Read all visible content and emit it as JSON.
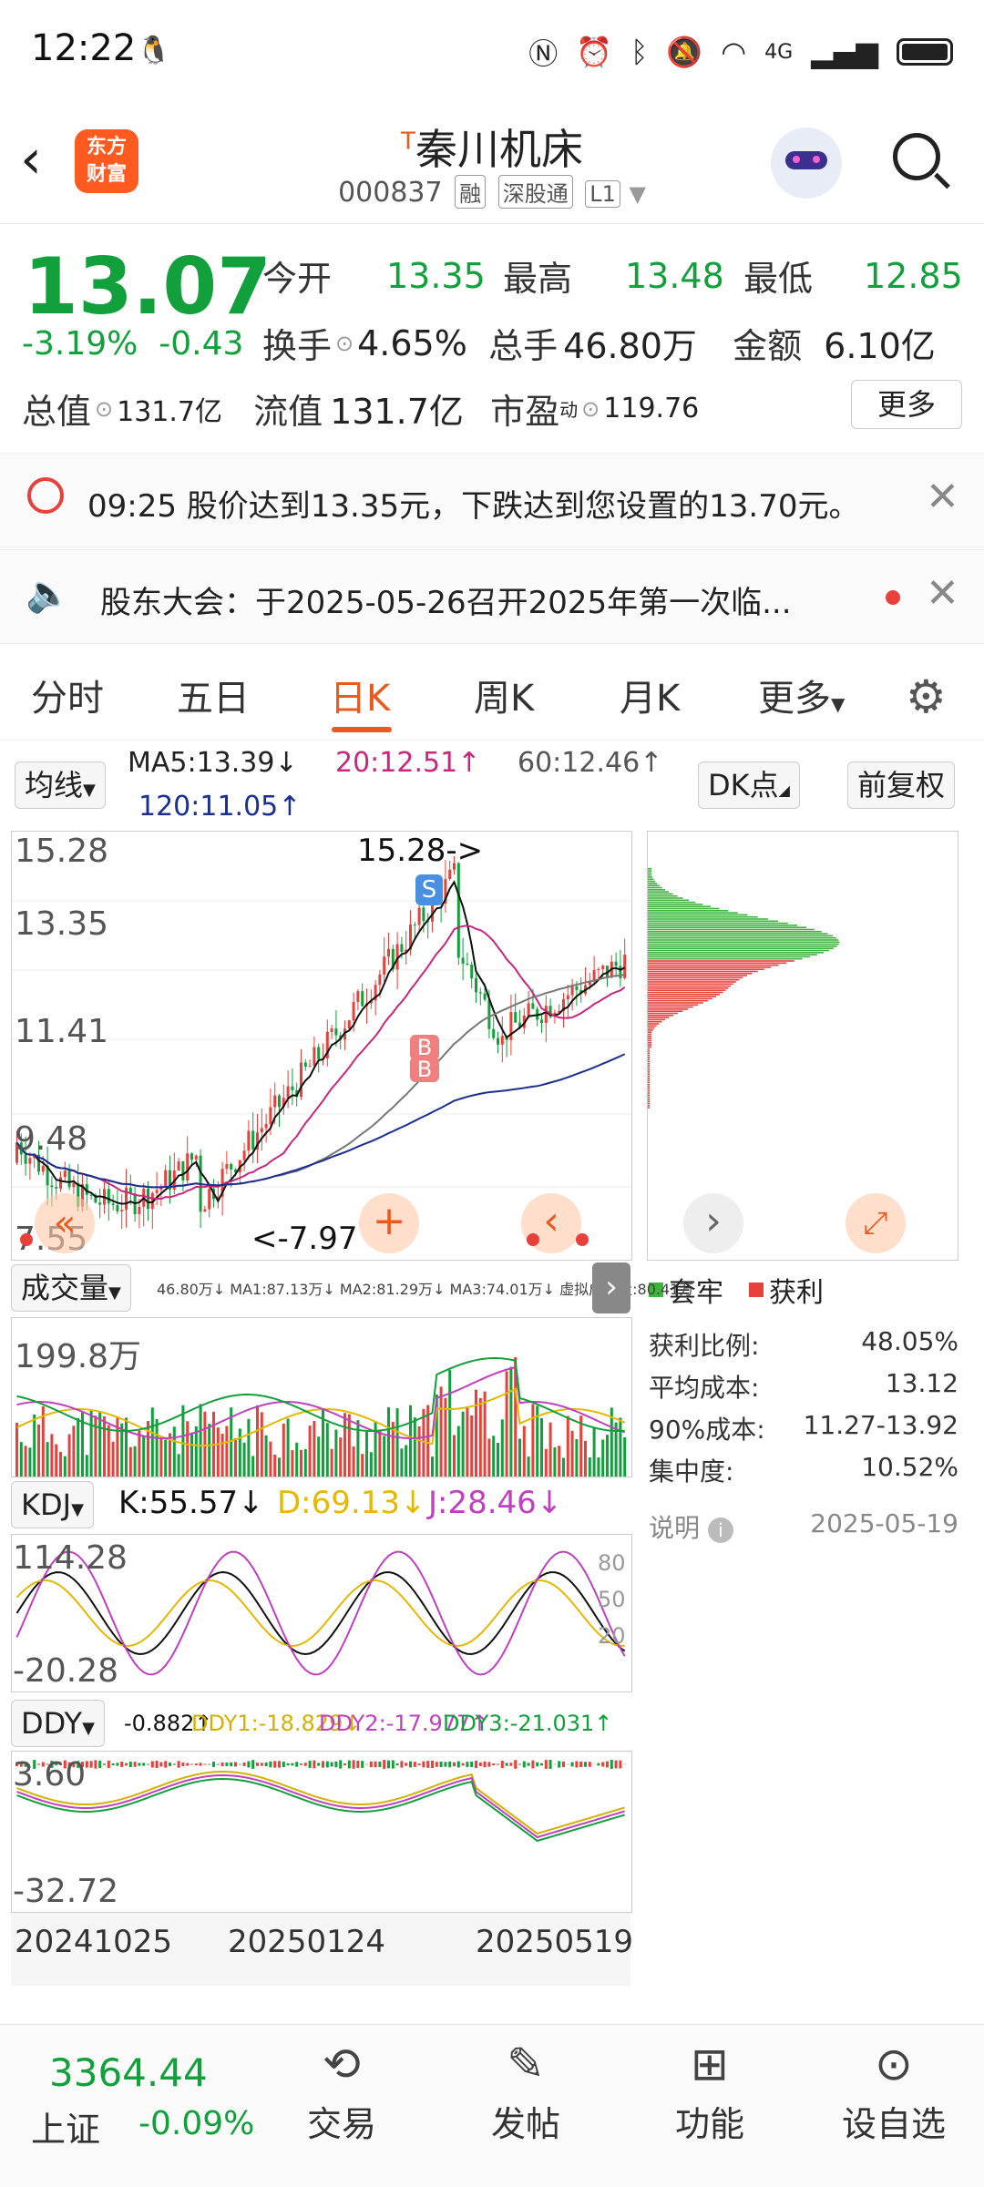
{
  "status_bar": {
    "time": "12:22",
    "network": "4G"
  },
  "header": {
    "logo_text": "东方\n财富",
    "stock_name": "秦川机床",
    "stock_prefix": "T",
    "stock_code": "000837",
    "tags": [
      "融",
      "深股通",
      "L1"
    ]
  },
  "quote": {
    "price": "13.07",
    "change_pct": "-3.19%",
    "change": "-0.43",
    "open_label": "今开",
    "open": "13.35",
    "high_label": "最高",
    "high": "13.48",
    "low_label": "最低",
    "low": "12.85",
    "turnover_label": "换手",
    "turnover": "4.65%",
    "volume_label": "总手",
    "volume": "46.80万",
    "amount_label": "金额",
    "amount": "6.10亿",
    "mktcap_label": "总值",
    "mktcap": "131.7亿",
    "float_label": "流值",
    "float": "131.7亿",
    "pe_label": "市盈",
    "pe_sup": "动",
    "pe": "119.76",
    "more_label": "更多"
  },
  "notices": [
    {
      "text": "09:25 股价达到13.35元，下跌达到您设置的13.70元。"
    },
    {
      "text": "股东大会：于2025-05-26召开2025年第一次临..."
    }
  ],
  "tabs": [
    {
      "label": "分时"
    },
    {
      "label": "五日"
    },
    {
      "label": "日K"
    },
    {
      "label": "周K"
    },
    {
      "label": "月K"
    },
    {
      "label": "更多"
    }
  ],
  "ma": {
    "selector": "均线",
    "ma5": "MA5:13.39↓",
    "ma20": "20:12.51↑",
    "ma60": "60:12.46↑",
    "ma120": "120:11.05↑",
    "dk": "DK点",
    "adjust": "前复权"
  },
  "kline": {
    "y_labels": [
      "15.28",
      "13.35",
      "11.41",
      "9.48",
      "7.55"
    ],
    "annot_high": "15.28->",
    "annot_low": "<-7.97",
    "sell_tag": "S",
    "buy_tags": [
      "B",
      "B"
    ]
  },
  "chips": {
    "legend_trapped": "套牢",
    "legend_profit": "获利",
    "stats": [
      {
        "label": "获利比例:",
        "value": "48.05%"
      },
      {
        "label": "平均成本:",
        "value": "13.12"
      },
      {
        "label": "90%成本:",
        "value": "11.27-13.92"
      },
      {
        "label": "集中度:",
        "value": "10.52%"
      }
    ],
    "note_label": "说明",
    "date": "2025-05-19"
  },
  "volume": {
    "selector": "成交量",
    "line": "46.80万↓ MA1:87.13万↓ MA2:81.29万↓ MA3:74.01万↓ 虚拟成交量:80.41万",
    "y_max": "199.8万"
  },
  "kdj": {
    "selector": "KDJ",
    "k": "K:55.57↓",
    "d": "D:69.13↓",
    "j": "J:28.46↓",
    "y_max": "114.28",
    "y_min": "-20.28",
    "levels": [
      "80",
      "50",
      "20"
    ]
  },
  "ddy": {
    "selector": "DDY",
    "v": "-0.882↑",
    "ddy1": "DDY1:-18.829↓",
    "ddy2": "DDY2:-17.977↑",
    "ddy3": "DDY3:-21.031↑",
    "y_max": "3.60",
    "y_min": "-32.72"
  },
  "dates": [
    "20241025",
    "20250124",
    "20250519"
  ],
  "bottom": {
    "index_value": "3364.44",
    "index_name": "上证",
    "index_change": "-0.09%",
    "nav": [
      {
        "label": "交易"
      },
      {
        "label": "发帖"
      },
      {
        "label": "功能"
      },
      {
        "label": "设自选"
      }
    ]
  },
  "colors": {
    "up": "#e8403a",
    "down": "#11a03c",
    "accent": "#e85a1e"
  }
}
